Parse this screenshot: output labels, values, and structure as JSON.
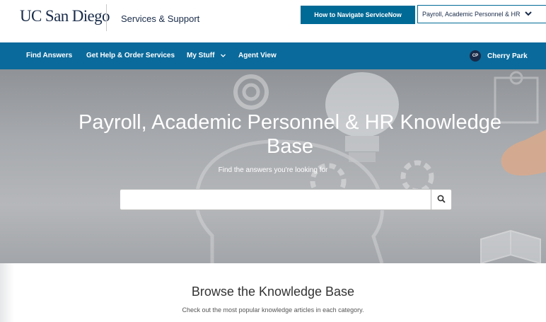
{
  "header": {
    "logo": "UC San Diego",
    "site_name": "Services & Support",
    "navigate_button": "How to Navigate ServiceNow",
    "kb_selector": "Payroll, Academic Personnel & HR"
  },
  "nav": {
    "items": [
      "Find Answers",
      "Get Help & Order Services",
      "My Stuff",
      "Agent View"
    ],
    "user_initials": "CP",
    "user_name": "Cherry Park"
  },
  "hero": {
    "title_line1": "Payroll, Academic Personnel & HR Knowledge",
    "title_line2": "Base",
    "subtitle": "Find the answers you're looking for",
    "search_value": ""
  },
  "browse": {
    "title": "Browse the Knowledge Base",
    "subtitle": "Check out the most popular knowledge articles in each category."
  },
  "colors": {
    "brand_navy": "#182b49",
    "nav_blue": "#0a6a9b",
    "button_blue": "#006a96"
  },
  "icons": {
    "search": "search-icon",
    "dropdown": "chevron-down-icon",
    "menu_caret": "caret-down-icon"
  }
}
